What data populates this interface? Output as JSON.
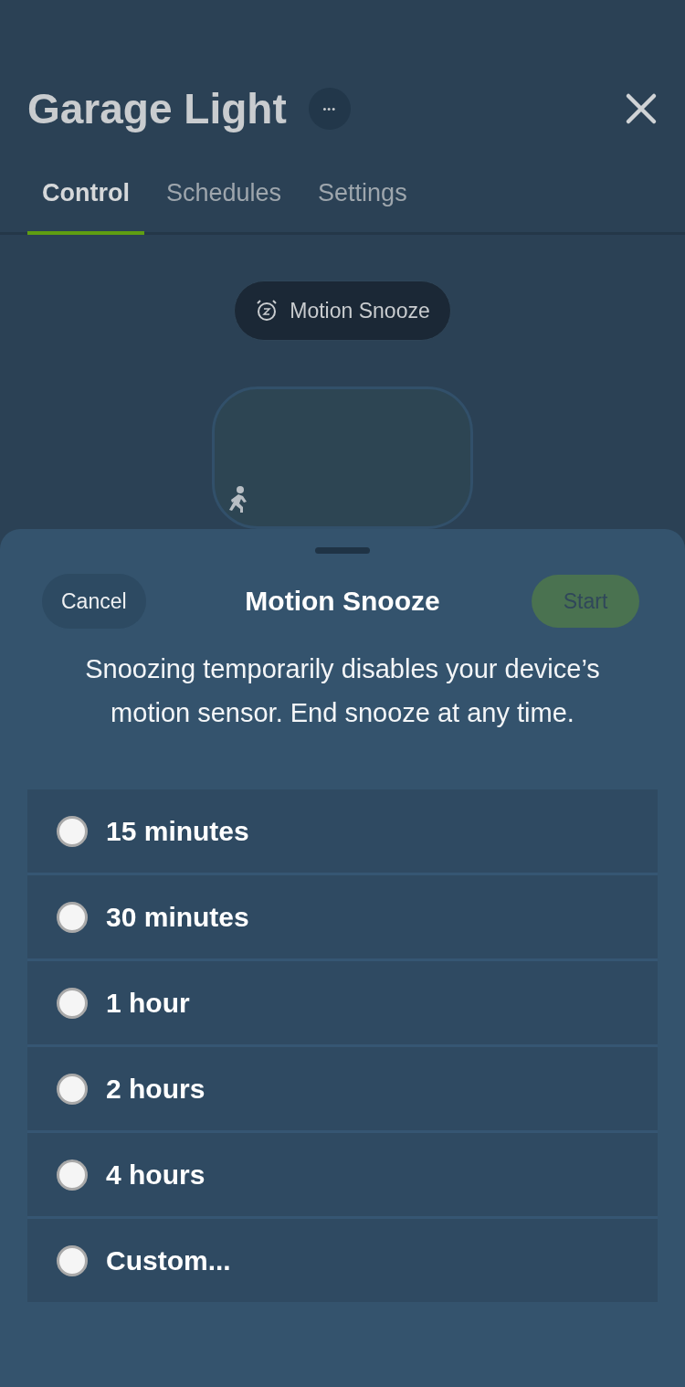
{
  "header": {
    "title": "Garage Light",
    "more_label": "•••"
  },
  "tabs": [
    {
      "label": "Control",
      "selected": true
    },
    {
      "label": "Schedules",
      "selected": false
    },
    {
      "label": "Settings",
      "selected": false
    }
  ],
  "snooze_pill": {
    "label": "Motion Snooze"
  },
  "sheet": {
    "cancel": "Cancel",
    "title": "Motion Snooze",
    "start": {
      "label": "Start",
      "disabled": true
    },
    "description": "Snoozing temporarily disables your device’s motion sensor. End snooze at any time.",
    "options": [
      {
        "label": "15 minutes",
        "selected": false
      },
      {
        "label": "30 minutes",
        "selected": false
      },
      {
        "label": "1 hour",
        "selected": false
      },
      {
        "label": "2 hours",
        "selected": false
      },
      {
        "label": "4 hours",
        "selected": false
      },
      {
        "label": "Custom...",
        "selected": false
      }
    ]
  }
}
